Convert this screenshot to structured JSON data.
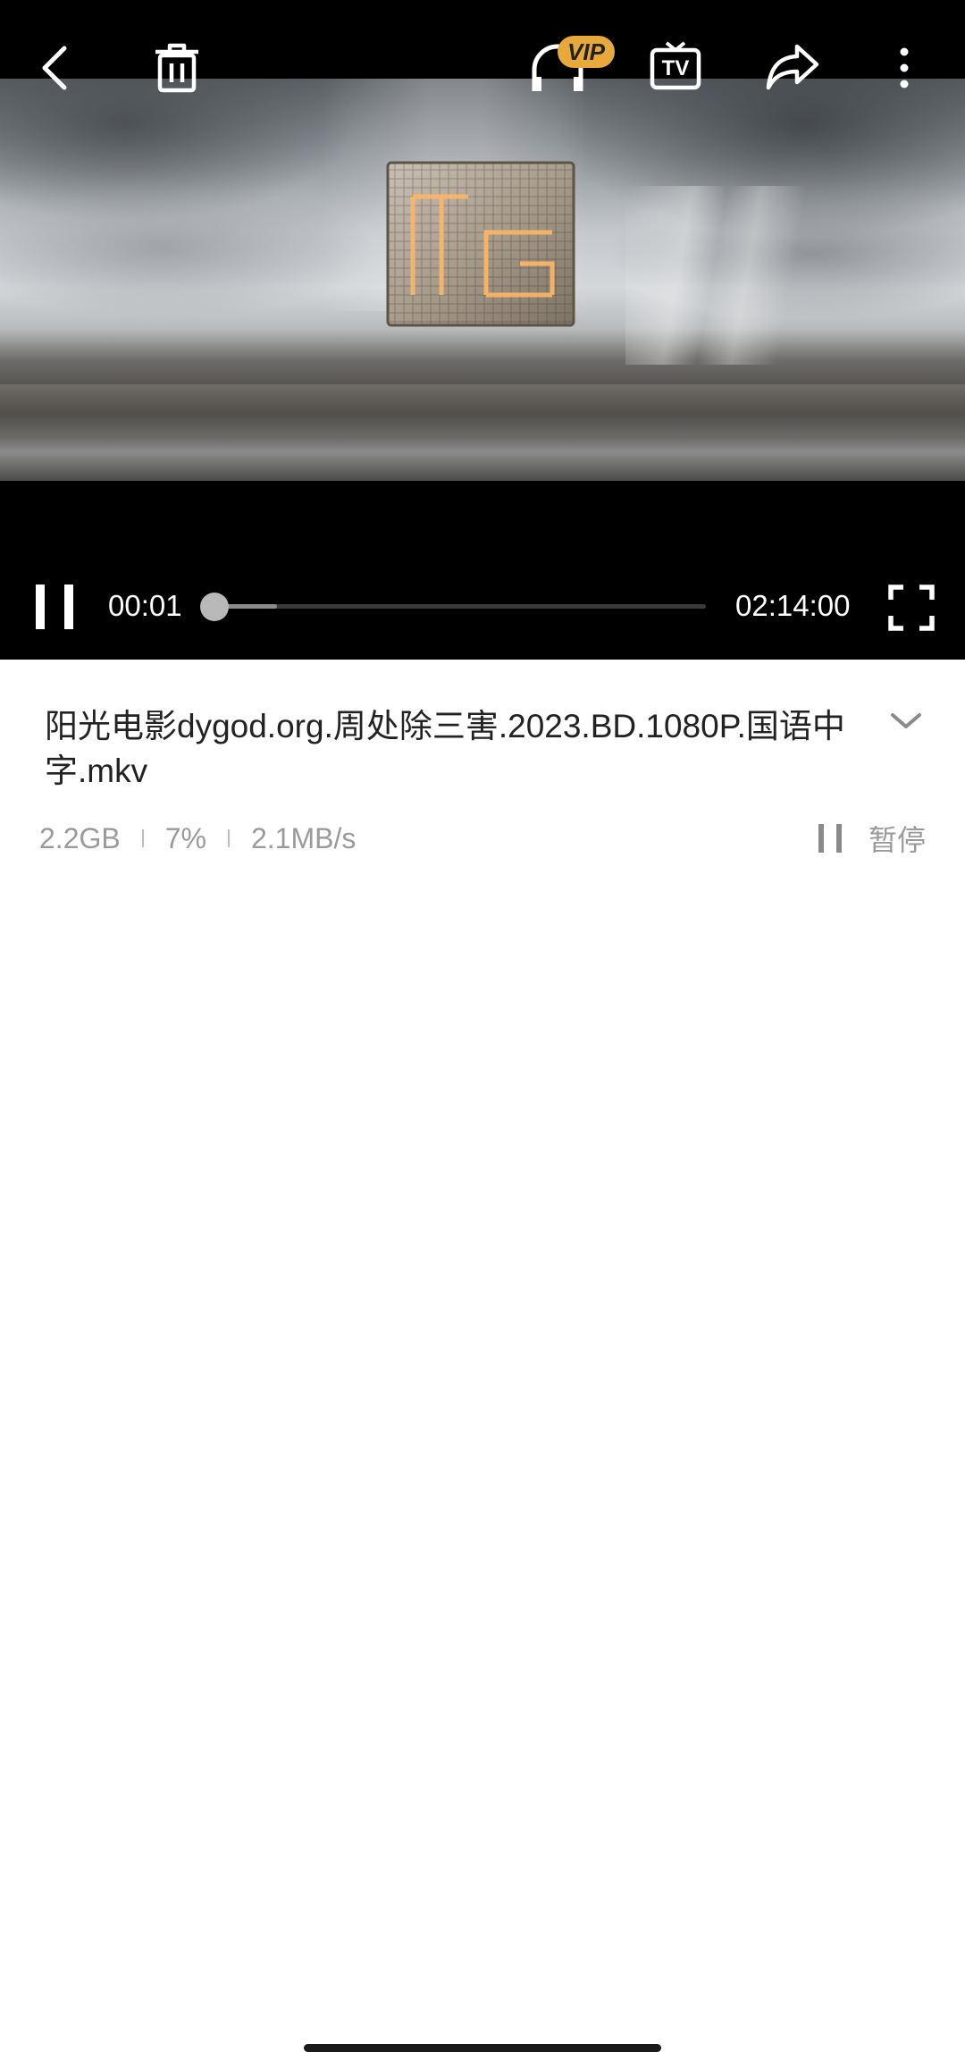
{
  "player": {
    "current_time": "00:01",
    "total_time": "02:14:00",
    "progress_fraction": 0.0,
    "buffered_fraction": 0.13,
    "vip_badge": "VIP",
    "tv_badge": "TV",
    "icons": [
      "back-icon",
      "trash-icon",
      "headphones-vip-icon",
      "tv-cast-icon",
      "share-icon",
      "more-vertical-icon",
      "pause-icon",
      "fullscreen-icon"
    ]
  },
  "file": {
    "title": "阳光电影dygod.org.周处除三害.2023.BD.1080P.国语中字.mkv",
    "size": "2.2GB",
    "percent": "7%",
    "speed": "2.1MB/s",
    "pause_label": "暂停"
  },
  "colors": {
    "player_bg": "#000000",
    "page_bg": "#ffffff",
    "vip_gold": "#e6a93a"
  }
}
